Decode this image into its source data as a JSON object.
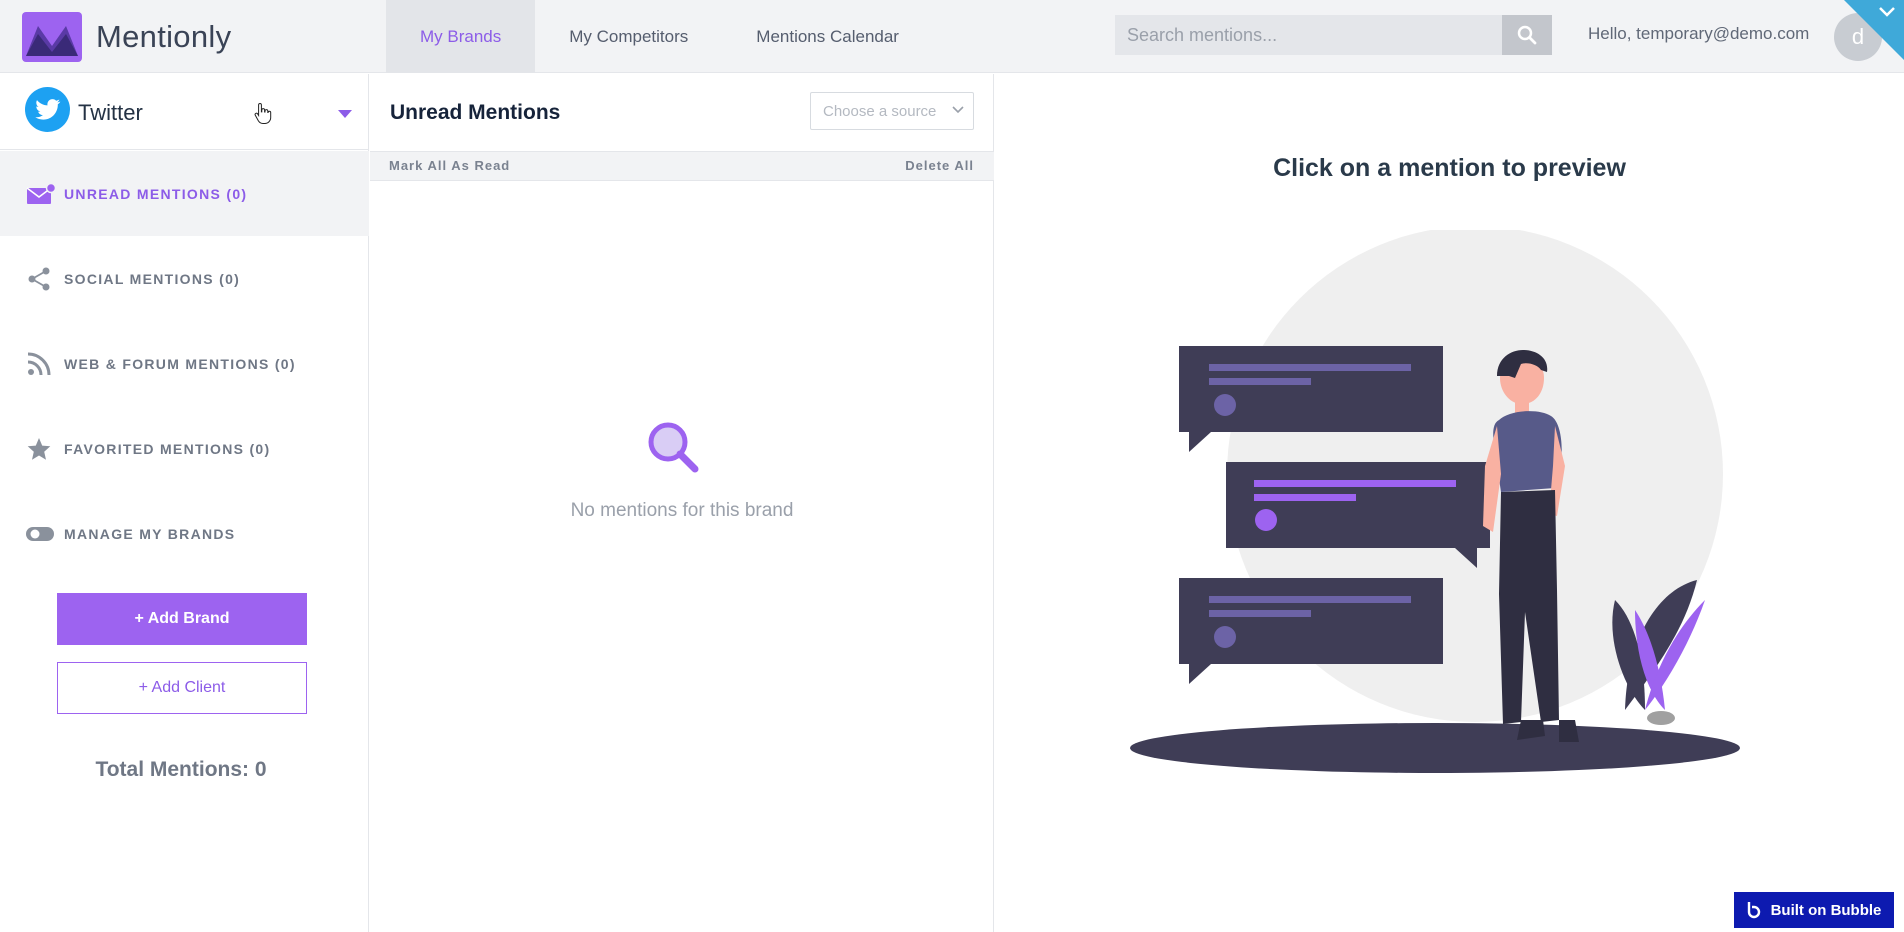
{
  "header": {
    "logo_text": "Mentionly",
    "nav": [
      {
        "label": "My Brands",
        "active": true
      },
      {
        "label": "My Competitors",
        "active": false
      },
      {
        "label": "Mentions Calendar",
        "active": false
      }
    ],
    "search_placeholder": "Search mentions...",
    "greeting": "Hello, temporary@demo.com",
    "avatar_initial": "d"
  },
  "sidebar": {
    "source_label": "Twitter",
    "menu": [
      {
        "label": "UNREAD MENTIONS (0)",
        "icon": "envelope-icon",
        "active": true
      },
      {
        "label": "SOCIAL MENTIONS (0)",
        "icon": "share-icon",
        "active": false
      },
      {
        "label": "WEB & FORUM MENTIONS (0)",
        "icon": "rss-icon",
        "active": false
      },
      {
        "label": "FAVORITED MENTIONS (0)",
        "icon": "star-icon",
        "active": false
      },
      {
        "label": "MANAGE MY BRANDS",
        "icon": "toggle-icon",
        "active": false
      }
    ],
    "add_brand": "+ Add Brand",
    "add_client": "+ Add Client",
    "total": "Total Mentions: 0"
  },
  "middle": {
    "title": "Unread Mentions",
    "source_placeholder": "Choose a source",
    "mark_all_read": "Mark All As Read",
    "delete_all": "Delete All",
    "empty_text": "No mentions for this brand"
  },
  "preview": {
    "title": "Click on a mention to preview"
  },
  "badge": {
    "label": "Built on Bubble"
  },
  "colors": {
    "accent": "#9d63f0",
    "twitter": "#1da1f2",
    "corner": "#3fa9d9",
    "bubble_badge": "#0d1ab0"
  }
}
